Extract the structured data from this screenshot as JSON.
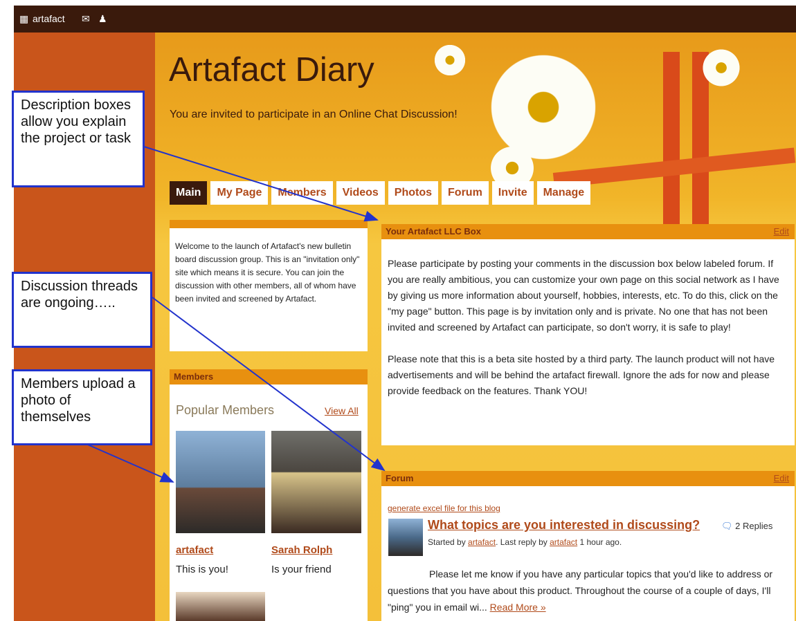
{
  "topbar": {
    "site_name": "artafact"
  },
  "header": {
    "title": "Artafact Diary",
    "tagline": "You are invited to participate in an Online Chat Discussion!"
  },
  "nav": [
    "Main",
    "My Page",
    "Members",
    "Videos",
    "Photos",
    "Forum",
    "Invite",
    "Manage"
  ],
  "welcome_text": "Welcome to the launch of Artafact's new bulletin board discussion group. This is an \"invitation only\" site which means it is secure. You can join the discussion with other members, all of whom have been invited and screened by Artafact.",
  "llc_box": {
    "title": "Your Artafact LLC Box",
    "edit": "Edit",
    "para1": "Please participate by posting your comments in the discussion box below labeled forum. If you are really ambitious, you can customize your own page on this social network as I have by giving us more information about yourself, hobbies, interests, etc. To do this, click on the \"my page\" button. This page is by invitation only and is private. No one that has not been invited and screened by Artafact can participate, so don't worry, it is safe to play!",
    "para2": "Please note that this is a beta site hosted by a third party. The launch product will not have advertisements and will be behind the artafact firewall. Ignore the ads for now and please provide feedback on the features. Thank YOU!"
  },
  "members_box": {
    "title": "Members",
    "subtitle": "Popular Members",
    "view_all": "View All",
    "members": [
      {
        "name": "artafact",
        "note": "This is you!"
      },
      {
        "name": "Sarah Rolph",
        "note": "Is your friend"
      }
    ]
  },
  "forum": {
    "title": "Forum",
    "edit": "Edit",
    "generate_link": "generate excel file for this blog",
    "thread_title": "What topics are you interested in discussing?",
    "replies": "2 Replies",
    "started_prefix": "Started by ",
    "started_by": "artafact",
    "last_reply_prefix": ". Last reply by ",
    "last_reply_by": "artafact",
    "last_reply_time": " 1 hour ago.",
    "body": "Please let me know if you have any particular topics that you'd like to address or questions that you have about this product. Throughout the course of a couple of days, I'll \"ping\" you in email wi...",
    "read_more": "Read More »"
  },
  "callouts": [
    "Description boxes allow you explain the project or task",
    "Discussion threads are ongoing…..",
    "Members upload a photo of themselves"
  ],
  "colors": {
    "accent": "#b04a1a",
    "topbar": "#3a1a0c",
    "box_header": "#e8900f",
    "callout_border": "#2233cc"
  }
}
